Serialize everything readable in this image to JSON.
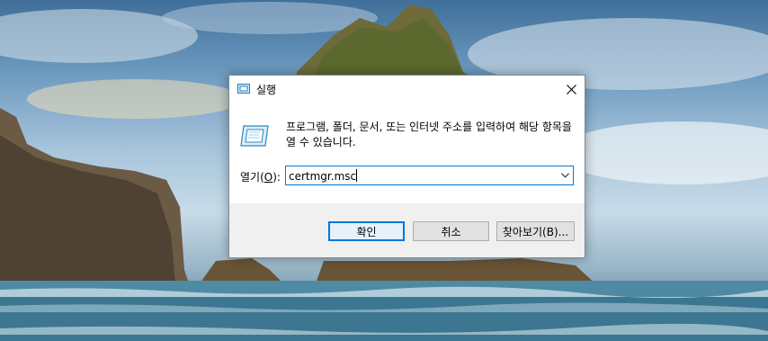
{
  "dialog": {
    "title": "실행",
    "description": "프로그램, 폴더, 문서, 또는 인터넷 주소를 입력하여 해당 항목을 열 수 있습니다.",
    "open_label_prefix": "열기(",
    "open_label_key": "O",
    "open_label_suffix": "):",
    "input_value": "certmgr.msc",
    "buttons": {
      "ok": "확인",
      "cancel": "취소",
      "browse": "찾아보기(B)..."
    }
  },
  "colors": {
    "accent": "#0078d7",
    "footer_bg": "#f0f0f0",
    "button_bg": "#e1e1e1"
  },
  "icons": {
    "title": "run-icon",
    "large": "run-icon",
    "close": "close-icon",
    "dropdown": "chevron-down-icon"
  }
}
